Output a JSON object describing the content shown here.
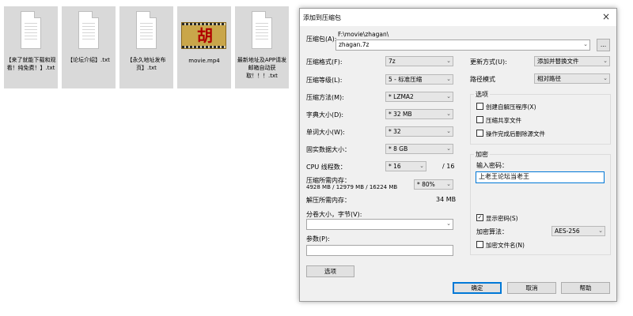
{
  "desktop": {
    "files": [
      {
        "name": "【来了就能下载和观看！纯免费！】.txt",
        "type": "txt"
      },
      {
        "name": "【论坛介绍】.txt",
        "type": "txt"
      },
      {
        "name": "【永久地址发布页】.txt",
        "type": "txt"
      },
      {
        "name": "movie.mp4",
        "type": "video"
      },
      {
        "name": "最新地址及APP请发邮箱自动获取！！！.txt",
        "type": "txt"
      }
    ],
    "video_thumb_glyph": "胡"
  },
  "dialog": {
    "title": "添加到压缩包",
    "close_icon": "×",
    "archive_label": "压缩包(A):",
    "archive_dir": "F:\\movie\\zhagan\\",
    "archive_name": "zhagan.7z",
    "browse_label": "...",
    "left": {
      "format_label": "压缩格式(F):",
      "format_value": "7z",
      "level_label": "压缩等级(L):",
      "level_value": "5 - 标准压缩",
      "method_label": "压缩方法(M):",
      "method_value": "* LZMA2",
      "dict_label": "字典大小(D):",
      "dict_value": "* 32 MB",
      "word_label": "单词大小(W):",
      "word_value": "* 32",
      "solid_label": "固实数据大小：",
      "solid_value": "* 8 GB",
      "threads_label": "CPU 线程数：",
      "threads_value": "* 16",
      "threads_total": "/ 16",
      "mem_label": "压缩所需内存：",
      "mem_detail": "4928 MB / 12979 MB / 16224 MB",
      "mem_value": "* 80%",
      "decomp_label": "解压所需内存：",
      "decomp_value": "34 MB",
      "split_label": "分卷大小，字节(V):",
      "split_value": "",
      "params_label": "参数(P):",
      "params_value": "",
      "options_button": "选项"
    },
    "right": {
      "update_label": "更新方式(U):",
      "update_value": "添加并替换文件",
      "path_label": "路径模式",
      "path_value": "相对路径",
      "options_group": "选项",
      "opt_sfx": "创建自解压程序(X)",
      "opt_shared": "压缩共享文件",
      "opt_delete": "操作完成后删除源文件",
      "encrypt_group": "加密",
      "pwd_label": "输入密码：",
      "pwd_value": "上老王论坛当老王",
      "show_pwd": "显示密码(S)",
      "enc_method_label": "加密算法：",
      "enc_method_value": "AES-256",
      "enc_names": "加密文件名(N)",
      "check_mark": "✓"
    },
    "buttons": {
      "ok": "确定",
      "cancel": "取消",
      "help": "帮助"
    },
    "arrow_glyph": "⌄"
  }
}
